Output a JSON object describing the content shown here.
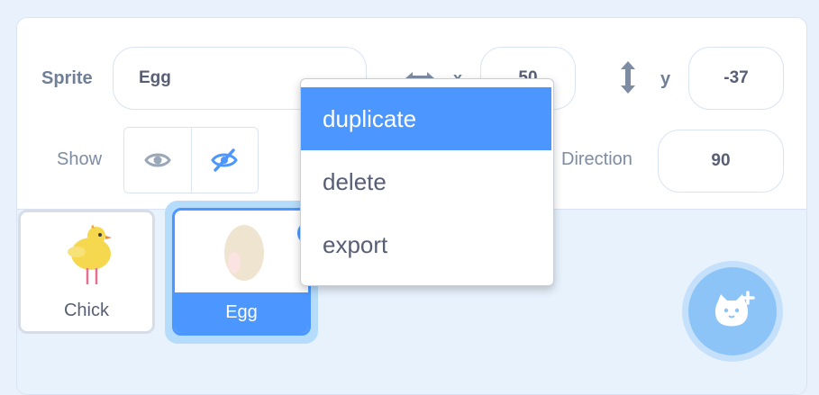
{
  "sprite_info": {
    "sprite_label": "Sprite",
    "sprite_name": "Egg",
    "x_label": "x",
    "x_value": "50",
    "y_label": "y",
    "y_value": "-37",
    "show_label": "Show",
    "direction_label": "Direction",
    "direction_value": "90"
  },
  "sprites": [
    {
      "name": "Chick",
      "selected": false
    },
    {
      "name": "Egg",
      "selected": true
    }
  ],
  "context_menu": {
    "items": [
      {
        "label": "duplicate",
        "highlighted": true
      },
      {
        "label": "delete",
        "highlighted": false
      },
      {
        "label": "export",
        "highlighted": false
      }
    ]
  },
  "colors": {
    "accent": "#4c97ff",
    "text": "#575e75",
    "selection_glow": "#b6dcfb",
    "add_button": "#8cc4f7"
  }
}
